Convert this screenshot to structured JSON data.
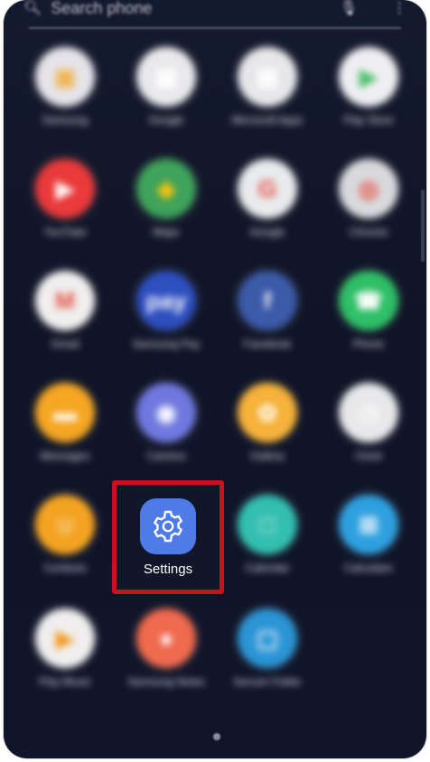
{
  "search": {
    "placeholder": "Search phone"
  },
  "apps": [
    {
      "label": "Samsung",
      "icon": "gallery-icon",
      "color": "#e6e4ea",
      "accent": "#f2b34a"
    },
    {
      "label": "Google",
      "icon": "google-folder-icon",
      "color": "#e9e9ec",
      "accent": "#ffffff"
    },
    {
      "label": "Microsoft Apps",
      "icon": "microsoft-folder-icon",
      "color": "#e7e7ea",
      "accent": "#ffffff"
    },
    {
      "label": "Play Store",
      "icon": "play-store-icon",
      "color": "#efeff2",
      "accent": "#4bbf6b"
    },
    {
      "label": "YouTube",
      "icon": "youtube-icon",
      "color": "#ea3a3b",
      "accent": "#ffffff"
    },
    {
      "label": "Maps",
      "icon": "maps-icon",
      "color": "#3fa35b",
      "accent": "#f4c20d"
    },
    {
      "label": "Google",
      "icon": "google-icon",
      "color": "#e9eaec",
      "accent": "#ea4335"
    },
    {
      "label": "Chrome",
      "icon": "chrome-icon",
      "color": "#d9d9dd",
      "accent": "#ea4335"
    },
    {
      "label": "Gmail",
      "icon": "gmail-icon",
      "color": "#f0eeee",
      "accent": "#e24a3b"
    },
    {
      "label": "Samsung Pay",
      "icon": "samsung-pay-icon",
      "color": "#2d4fbf",
      "accent": "#ffffff"
    },
    {
      "label": "Facebook",
      "icon": "facebook-icon",
      "color": "#3b5aa8",
      "accent": "#ffffff"
    },
    {
      "label": "Phone",
      "icon": "phone-icon",
      "color": "#2fbf67",
      "accent": "#ffffff"
    },
    {
      "label": "Messages",
      "icon": "messages-icon",
      "color": "#f5a623",
      "accent": "#ffffff"
    },
    {
      "label": "Camera",
      "icon": "camera-icon",
      "color": "#6f78df",
      "accent": "#ffffff"
    },
    {
      "label": "Gallery",
      "icon": "gallery-flower-icon",
      "color": "#f6b23a",
      "accent": "#ffffff"
    },
    {
      "label": "Clock",
      "icon": "clock-icon",
      "color": "#e8e8ea",
      "accent": "#ffffff"
    },
    {
      "label": "Contacts",
      "icon": "contacts-icon",
      "color": "#f3a322",
      "accent": "#ffffff"
    },
    {
      "label": "Calendar",
      "icon": "calendar-icon",
      "color": "#33bfb0",
      "accent": "#ffffff"
    },
    {
      "label": "Calculator",
      "icon": "calculator-icon",
      "color": "#2fa0df",
      "accent": "#ffffff"
    },
    {
      "label": "Play Music",
      "icon": "play-music-icon",
      "color": "#f0eeee",
      "accent": "#f39a20"
    },
    {
      "label": "Samsung Notes",
      "icon": "samsung-notes-icon",
      "color": "#ef6a4e",
      "accent": "#ffffff"
    },
    {
      "label": "Secure Folder",
      "icon": "secure-folder-icon",
      "color": "#2c95d6",
      "accent": "#ffffff"
    }
  ],
  "settings": {
    "label": "Settings",
    "icon": "settings-gear-icon",
    "color": "#4f7be9"
  },
  "highlight_color": "#c9121b"
}
